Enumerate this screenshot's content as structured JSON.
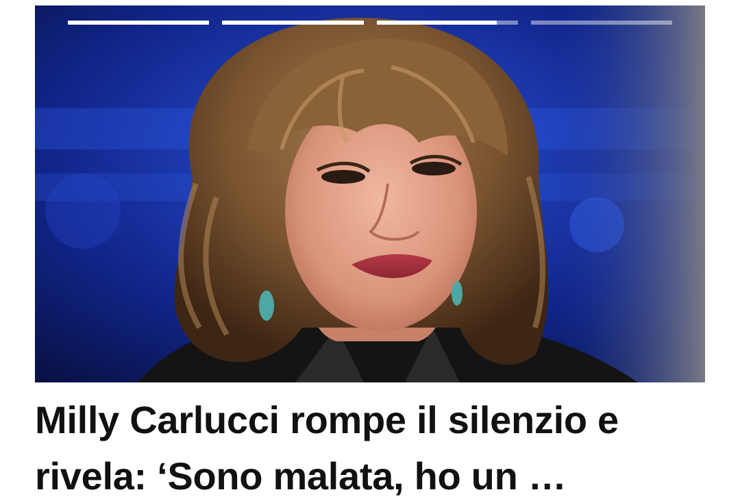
{
  "story": {
    "headline_line1": "Milly Carlucci rompe il silenzio e",
    "headline_line2": "rivela: ‘Sono malata, ho un …",
    "progress_segments": [
      1.0,
      1.0,
      0.85,
      0.0
    ],
    "image_subject": "portrait-photo"
  },
  "colors": {
    "progress_active": "#ffffff",
    "progress_inactive": "rgba(255,255,255,0.45)",
    "headline_text": "#111111",
    "background_blue": "#1236b8"
  }
}
